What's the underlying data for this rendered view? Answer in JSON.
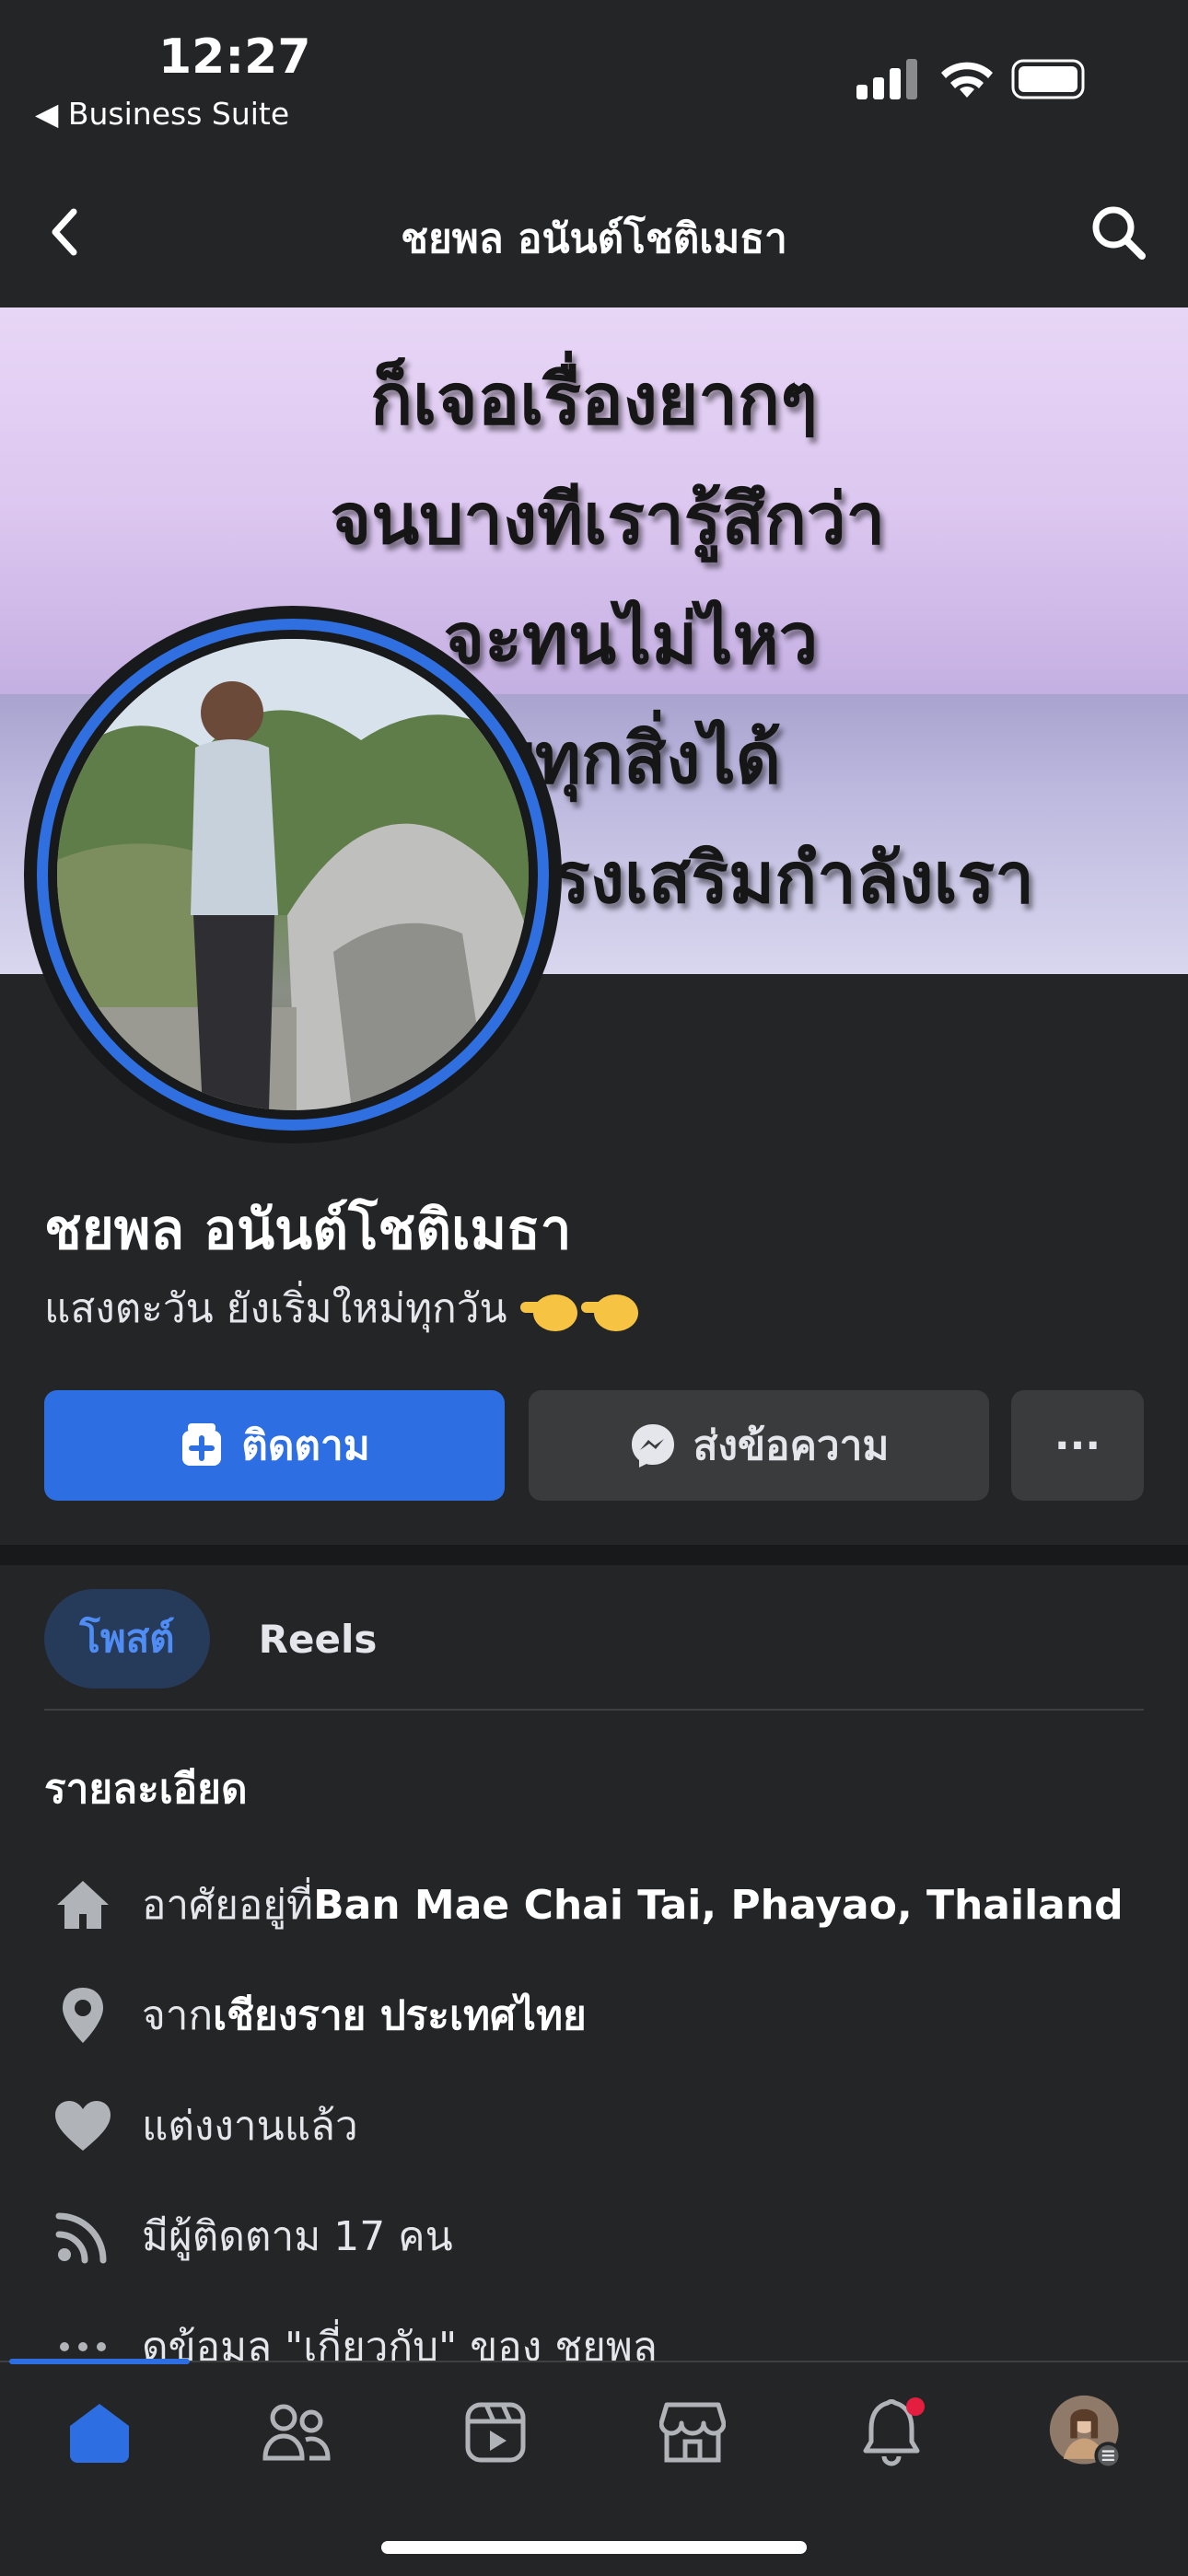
{
  "status": {
    "time": "12:27",
    "back_app": "◀ Business Suite"
  },
  "nav": {
    "title": "ชยพล อนันต์โชติเมธา"
  },
  "cover": {
    "lines": [
      "ก็เจอเรื่องยากๆ",
      "จนบางทีเรารู้สึกว่า",
      "จะทนไม่ไหว",
      "ผชิญทุกสิ่งได้",
      "รงเสริมกำลังเรา"
    ]
  },
  "profile": {
    "name": "ชยพล อนันต์โชติเมธา",
    "bio": "แสงตะวัน ยังเริ่มใหม่ทุกวัน"
  },
  "actions": {
    "follow": "ติดตาม",
    "message": "ส่งข้อความ",
    "more": "···"
  },
  "tabs": [
    {
      "label": "โพสต์",
      "active": true
    },
    {
      "label": "Reels",
      "active": false
    }
  ],
  "details": {
    "title": "รายละเอียด",
    "rows": [
      {
        "icon": "home-icon",
        "prefix": "อาศัยอยู่ที่ ",
        "value": "Ban Mae Chai Tai, Phayao, Thailand"
      },
      {
        "icon": "location-pin-icon",
        "prefix": "จาก ",
        "value": "เชียงราย ประเทศไทย"
      },
      {
        "icon": "heart-icon",
        "prefix": "",
        "value": "แต่งงานแล้ว"
      },
      {
        "icon": "rss-icon",
        "prefix": "",
        "value": "มีผู้ติดตาม 17 คน"
      },
      {
        "icon": "more-dots-icon",
        "prefix": "",
        "value": "ดูข้อมูล \"เกี่ยวกับ\" ของ ชยพล"
      }
    ]
  },
  "colors": {
    "accent": "#2d6fe2",
    "background": "#242527",
    "button_secondary": "#3a3b3c",
    "notification": "#e41e3f"
  }
}
